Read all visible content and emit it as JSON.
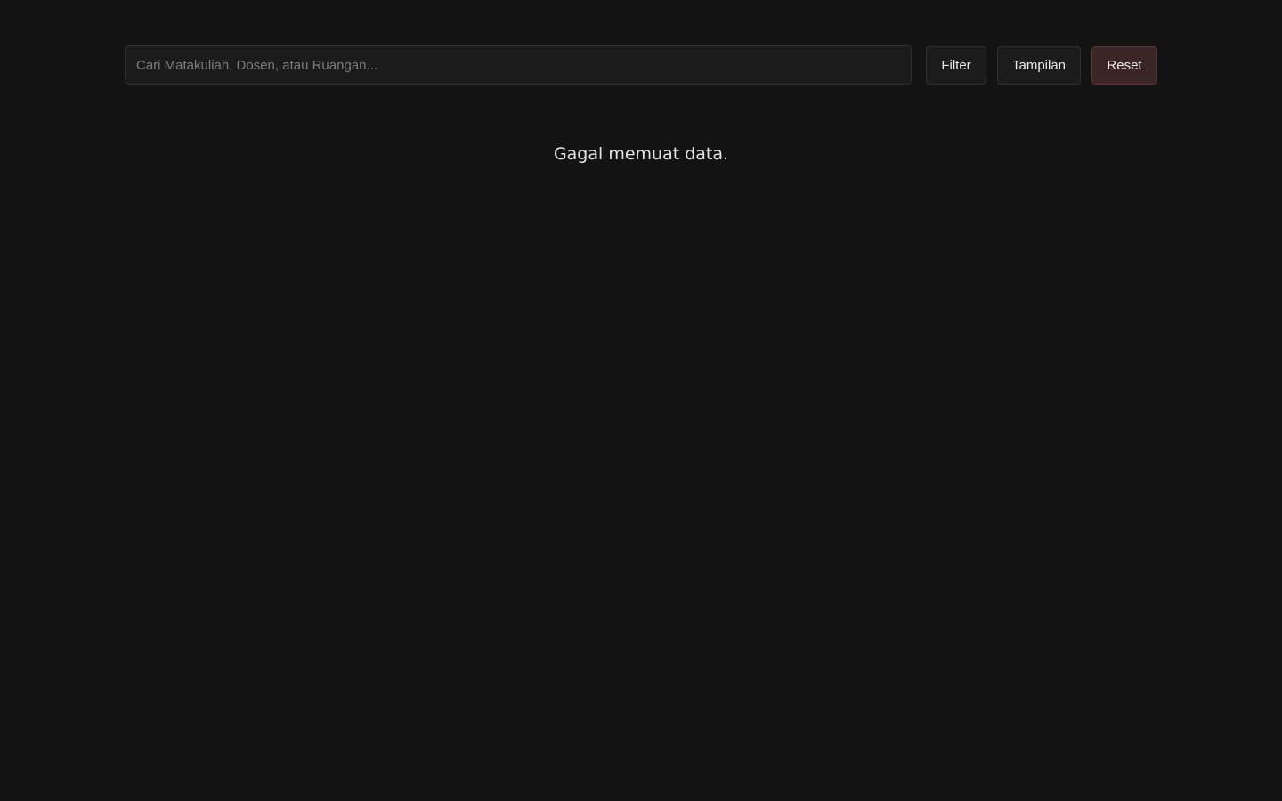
{
  "toolbar": {
    "search": {
      "placeholder": "Cari Matakuliah, Dosen, atau Ruangan...",
      "value": ""
    },
    "filter_label": "Filter",
    "view_label": "Tampilan",
    "reset_label": "Reset"
  },
  "main": {
    "status_message": "Gagal memuat data."
  },
  "colors": {
    "background": "#131313",
    "input_bg": "#1b1b1b",
    "button_bg": "#1c1c1c",
    "reset_bg": "#3a2627",
    "reset_border": "#5a3537"
  }
}
